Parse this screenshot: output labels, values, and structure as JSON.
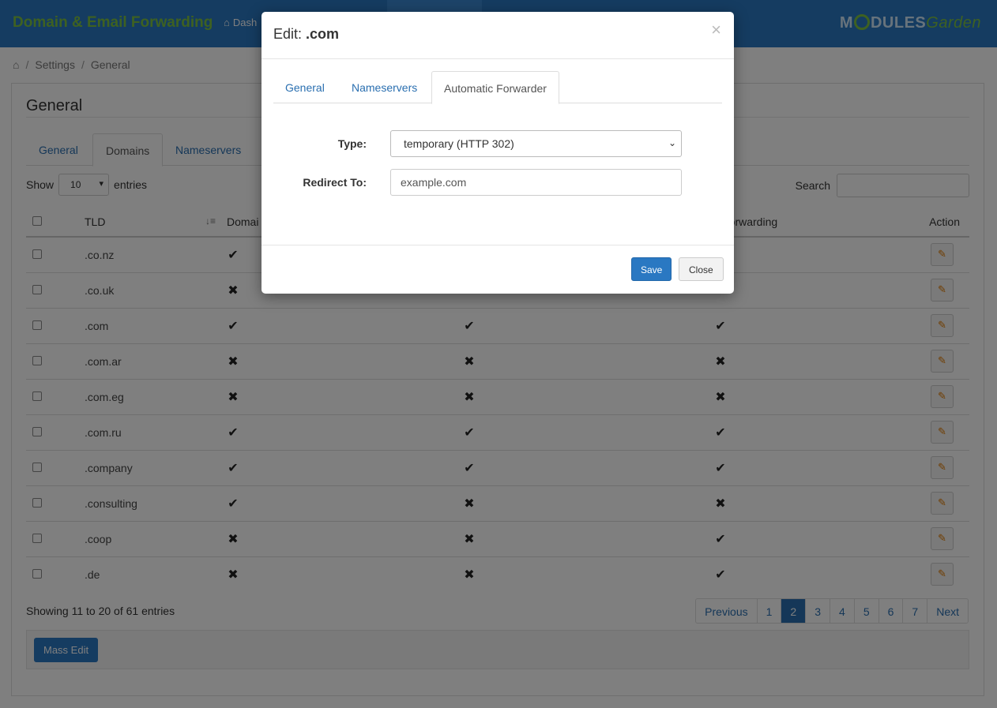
{
  "header": {
    "app_title": "Domain & Email Forwarding",
    "nav_dashboard": "Dash",
    "logo_part1": "M",
    "logo_part2": "DULES",
    "logo_part3": "Garden"
  },
  "breadcrumb": {
    "items": [
      "Settings",
      "General"
    ]
  },
  "panel": {
    "title": "General",
    "tabs": [
      {
        "label": "General"
      },
      {
        "label": "Domains"
      },
      {
        "label": "Nameservers"
      }
    ]
  },
  "table_controls": {
    "show_label": "Show",
    "entries_value": "10",
    "entries_label": "entries",
    "search_label": "Search"
  },
  "table": {
    "columns": [
      "TLD",
      "Domai",
      "il Forwarding",
      "Action"
    ],
    "rows": [
      {
        "tld": ".co.nz",
        "domain": "✔",
        "ns": "",
        "email": ""
      },
      {
        "tld": ".co.uk",
        "domain": "✖",
        "ns": "",
        "email": ""
      },
      {
        "tld": ".com",
        "domain": "✔",
        "ns": "✔",
        "email": "✔"
      },
      {
        "tld": ".com.ar",
        "domain": "✖",
        "ns": "✖",
        "email": "✖"
      },
      {
        "tld": ".com.eg",
        "domain": "✖",
        "ns": "✖",
        "email": "✖"
      },
      {
        "tld": ".com.ru",
        "domain": "✔",
        "ns": "✔",
        "email": "✔"
      },
      {
        "tld": ".company",
        "domain": "✔",
        "ns": "✔",
        "email": "✔"
      },
      {
        "tld": ".consulting",
        "domain": "✔",
        "ns": "✖",
        "email": "✖"
      },
      {
        "tld": ".coop",
        "domain": "✖",
        "ns": "✖",
        "email": "✔"
      },
      {
        "tld": ".de",
        "domain": "✖",
        "ns": "✖",
        "email": "✔"
      }
    ]
  },
  "footer": {
    "showing_text": "Showing 11 to 20 of 61 entries",
    "pagination": [
      "Previous",
      "1",
      "2",
      "3",
      "4",
      "5",
      "6",
      "7",
      "Next"
    ],
    "current_page": "2",
    "mass_edit_label": "Mass Edit"
  },
  "modal": {
    "title_prefix": "Edit:",
    "title_value": ".com",
    "close_symbol": "×",
    "tabs": [
      {
        "label": "General"
      },
      {
        "label": "Nameservers"
      },
      {
        "label": "Automatic Forwarder"
      }
    ],
    "type_label": "Type:",
    "type_value": "temporary (HTTP 302)",
    "redirect_label": "Redirect To:",
    "redirect_value": "example.com",
    "save_label": "Save",
    "close_label": "Close"
  },
  "colors": {
    "header_bg": "#2a78c2",
    "title_green": "#7dc242",
    "link_blue": "#2a6fb0"
  }
}
